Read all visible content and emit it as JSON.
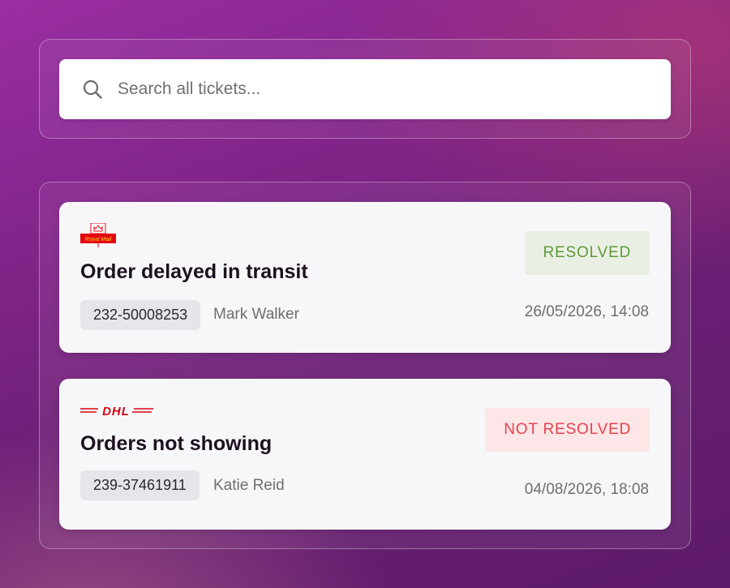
{
  "search": {
    "placeholder": "Search all tickets...",
    "value": "",
    "icon": "search-icon"
  },
  "tickets": [
    {
      "carrier": "Royal Mail",
      "carrier_logo_text": "Royal Mail",
      "carrier_color": "#e30613",
      "title": "Order delayed in transit",
      "id": "232-50008253",
      "assignee": "Mark Walker",
      "status": "RESOLVED",
      "status_color": "#5e9a38",
      "timestamp": "26/05/2026, 14:08"
    },
    {
      "carrier": "DHL",
      "carrier_logo_text": "DHL",
      "carrier_color": "#d40511",
      "title": "Orders not showing",
      "id": "239-37461911",
      "assignee": "Katie Reid",
      "status": "NOT RESOLVED",
      "status_color": "#e8414c",
      "timestamp": "04/08/2026, 18:08"
    }
  ]
}
